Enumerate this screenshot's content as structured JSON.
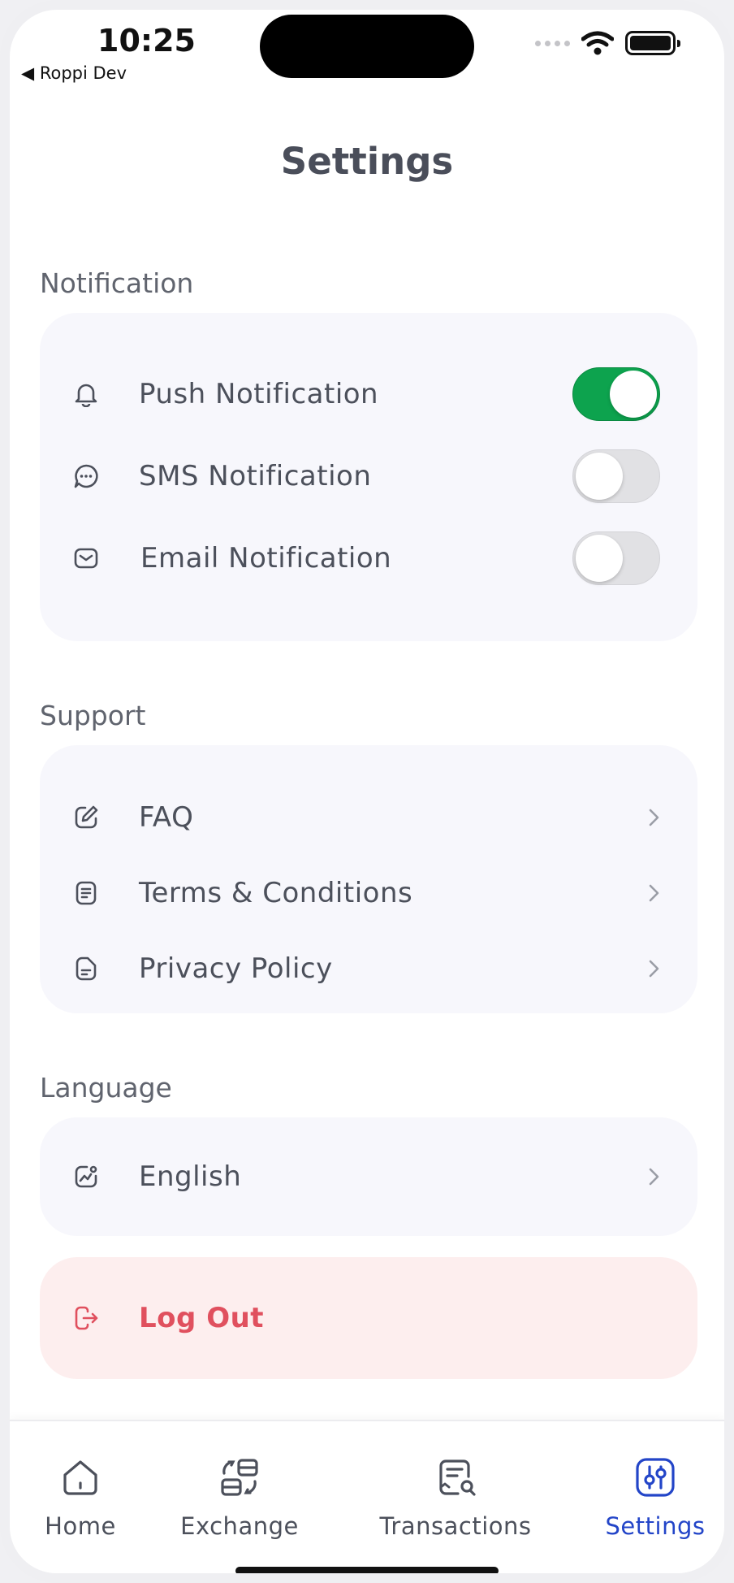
{
  "status": {
    "time": "10:25",
    "back_label": "◀ Roppi Dev"
  },
  "page": {
    "title": "Settings"
  },
  "notification": {
    "section_label": "Notification",
    "items": [
      {
        "label": "Push Notification",
        "icon": "bell-icon",
        "enabled": true
      },
      {
        "label": "SMS Notification",
        "icon": "chat-bubble-icon",
        "enabled": false
      },
      {
        "label": "Email Notification",
        "icon": "mail-icon",
        "enabled": false
      }
    ]
  },
  "support": {
    "section_label": "Support",
    "items": [
      {
        "label": "FAQ",
        "icon": "edit-icon"
      },
      {
        "label": "Terms & Conditions",
        "icon": "document-list-icon"
      },
      {
        "label": "Privacy Policy",
        "icon": "file-icon"
      }
    ]
  },
  "language": {
    "section_label": "Language",
    "current": "English",
    "icon": "language-chart-icon"
  },
  "logout": {
    "label": "Log Out",
    "icon": "logout-icon"
  },
  "tabbar": {
    "tabs": [
      {
        "label": "Home",
        "icon": "home-icon",
        "active": false
      },
      {
        "label": "Exchange",
        "icon": "exchange-icon",
        "active": false
      },
      {
        "label": "Transactions",
        "icon": "receipt-search-icon",
        "active": false
      },
      {
        "label": "Settings",
        "icon": "sliders-icon",
        "active": true
      }
    ]
  },
  "colors": {
    "accent_green": "#0da34e",
    "active_tab": "#2345c8",
    "logout_red": "#e0505e"
  }
}
